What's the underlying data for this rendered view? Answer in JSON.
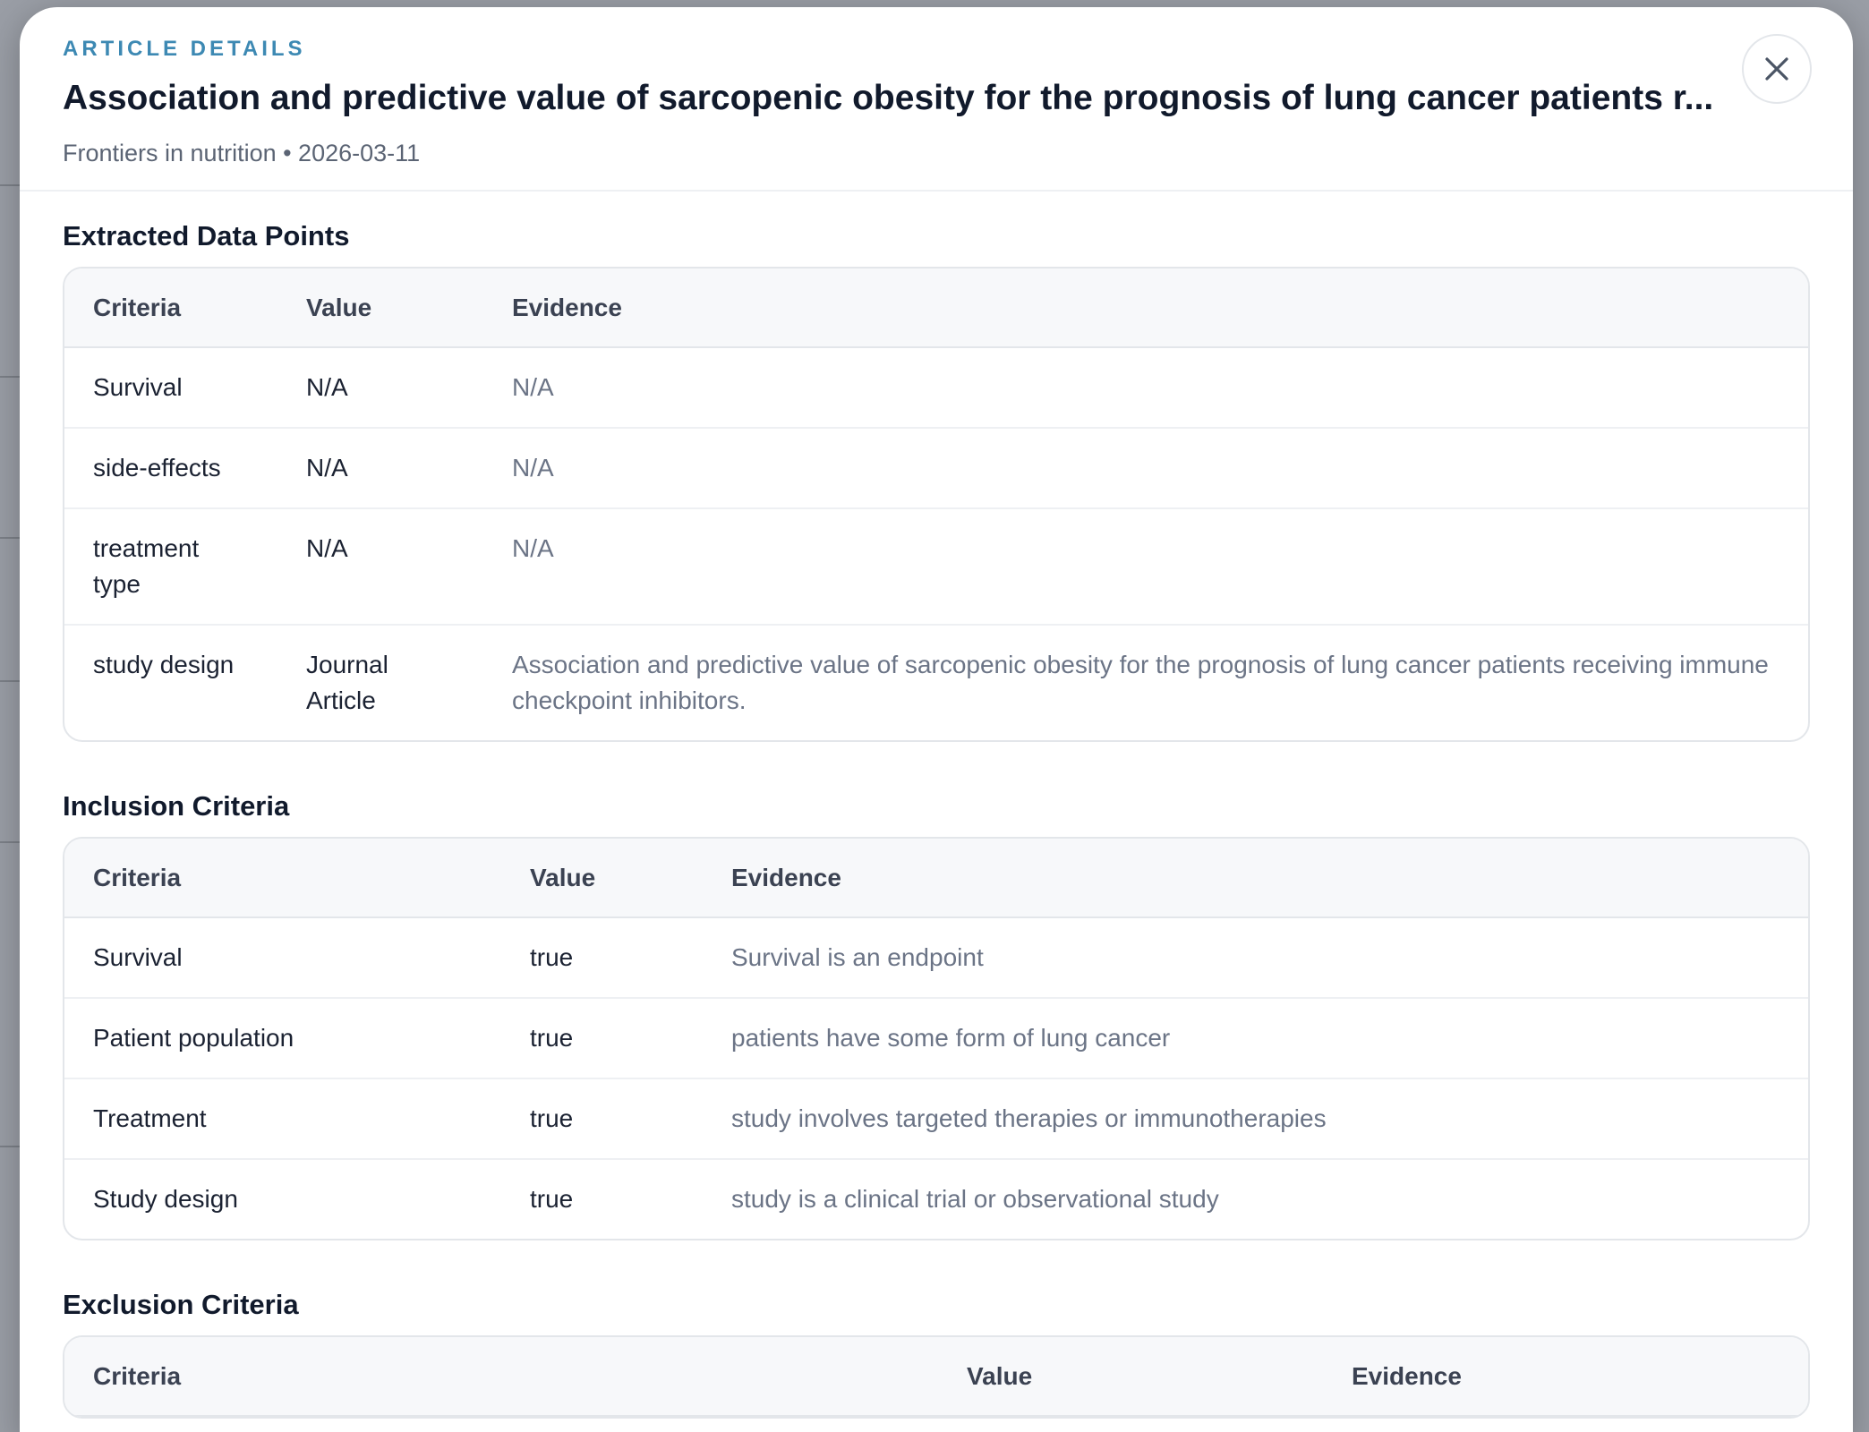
{
  "header": {
    "eyebrow": "ARTICLE DETAILS",
    "title": "Association and predictive value of sarcopenic obesity for the prognosis of lung cancer patients r...",
    "meta": "Frontiers in nutrition • 2026-03-11",
    "close_label": "Close"
  },
  "extracted": {
    "heading": "Extracted Data Points",
    "columns": [
      "Criteria",
      "Value",
      "Evidence"
    ],
    "rows": [
      {
        "criteria": "Survival",
        "value": "N/A",
        "evidence": "N/A"
      },
      {
        "criteria": "side-effects",
        "value": "N/A",
        "evidence": "N/A"
      },
      {
        "criteria": "treatment type",
        "value": "N/A",
        "evidence": "N/A"
      },
      {
        "criteria": "study design",
        "value": "Journal Article",
        "evidence": "Association and predictive value of sarcopenic obesity for the prognosis of lung cancer patients receiving immune checkpoint inhibitors."
      }
    ]
  },
  "inclusion": {
    "heading": "Inclusion Criteria",
    "columns": [
      "Criteria",
      "Value",
      "Evidence"
    ],
    "rows": [
      {
        "criteria": "Survival",
        "value": "true",
        "evidence": "Survival is an endpoint"
      },
      {
        "criteria": "Patient population",
        "value": "true",
        "evidence": "patients have some form of lung cancer"
      },
      {
        "criteria": "Treatment",
        "value": "true",
        "evidence": "study involves targeted therapies or immunotherapies"
      },
      {
        "criteria": "Study design",
        "value": "true",
        "evidence": "study is a clinical trial or observational study"
      }
    ]
  },
  "exclusion": {
    "heading": "Exclusion Criteria",
    "columns": [
      "Criteria",
      "Value",
      "Evidence"
    ]
  },
  "colors": {
    "eyebrow": "#3d89b3",
    "title": "#111a2c",
    "evidence_text": "#6b7486"
  },
  "icons": {
    "close": "close-icon"
  }
}
